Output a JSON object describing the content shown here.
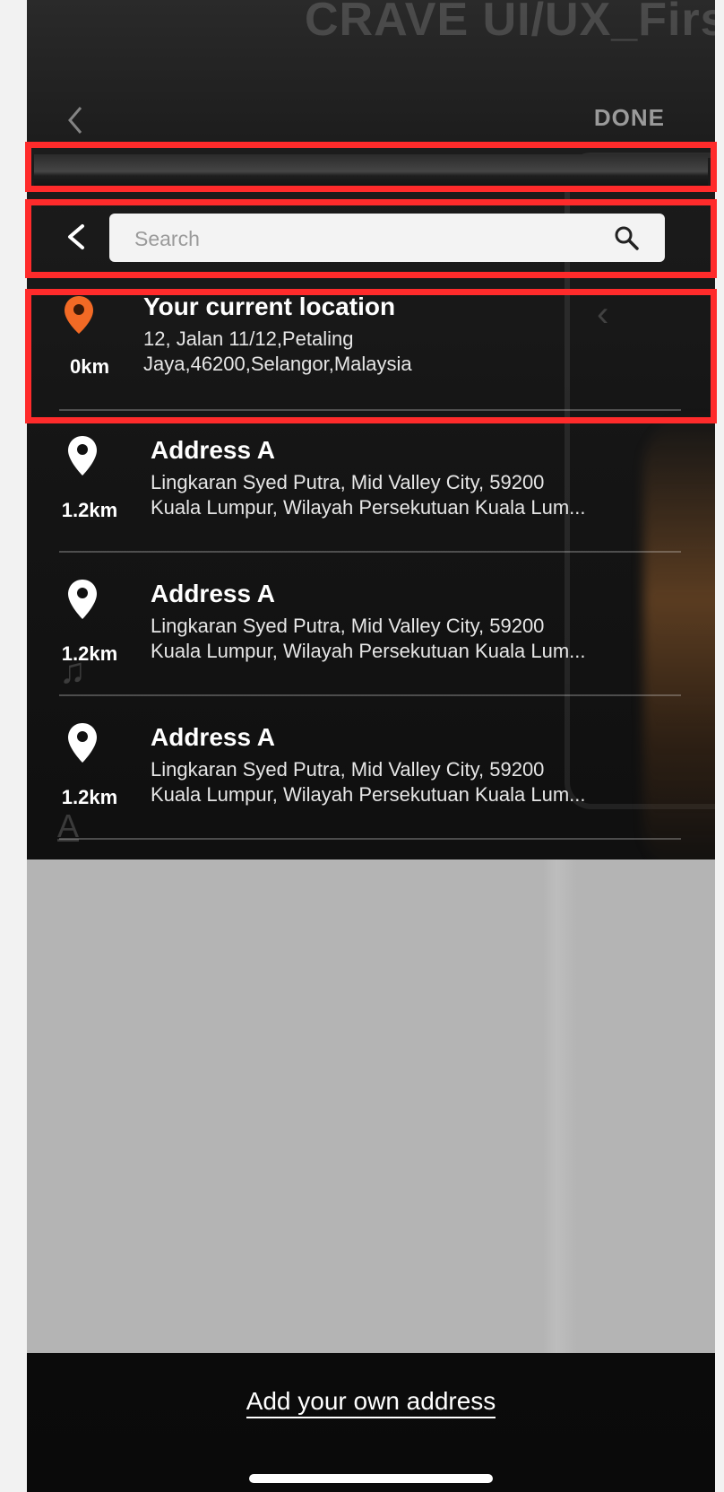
{
  "background": {
    "app_title": "CRAVE UI/UX_Firs"
  },
  "top_bar": {
    "back_icon": "chevron-left-icon",
    "done_label": "DONE"
  },
  "search": {
    "placeholder": "Search",
    "value": "",
    "back_icon": "chevron-left-icon",
    "search_icon": "magnifier-icon"
  },
  "current_location": {
    "title": "Your current location",
    "address_line1": "12, Jalan 11/12,Petaling",
    "address_line2": "Jaya,46200,Selangor,Malaysia",
    "distance": "0km",
    "pin_color": "#f26a25"
  },
  "addresses": [
    {
      "title": "Address A",
      "address_line1": "Lingkaran Syed Putra, Mid Valley City, 59200",
      "address_line2": "Kuala Lumpur, Wilayah Persekutuan Kuala Lum...",
      "distance": "1.2km"
    },
    {
      "title": "Address A",
      "address_line1": "Lingkaran Syed Putra, Mid Valley City, 59200",
      "address_line2": "Kuala Lumpur, Wilayah Persekutuan Kuala Lum...",
      "distance": "1.2km"
    },
    {
      "title": "Address A",
      "address_line1": "Lingkaran Syed Putra, Mid Valley City, 59200",
      "address_line2": "Kuala Lumpur, Wilayah Persekutuan Kuala Lum...",
      "distance": "1.2km"
    }
  ],
  "footer": {
    "add_address_label": "Add your own address"
  },
  "colors": {
    "highlight": "#ff2b2b",
    "overlay": "#b4b4b4",
    "accent_pin": "#f26a25"
  }
}
